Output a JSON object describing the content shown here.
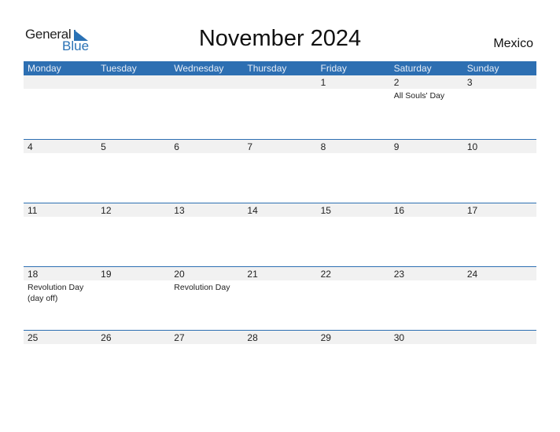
{
  "logo": {
    "word1": "General",
    "word2": "Blue"
  },
  "title": "November 2024",
  "country": "Mexico",
  "colors": {
    "accent": "#2d6fb2",
    "band": "#f1f1f1"
  },
  "weekdays": [
    "Monday",
    "Tuesday",
    "Wednesday",
    "Thursday",
    "Friday",
    "Saturday",
    "Sunday"
  ],
  "weeks": [
    [
      {
        "d": ""
      },
      {
        "d": ""
      },
      {
        "d": ""
      },
      {
        "d": ""
      },
      {
        "d": "1"
      },
      {
        "d": "2",
        "h": "All Souls' Day"
      },
      {
        "d": "3"
      }
    ],
    [
      {
        "d": "4"
      },
      {
        "d": "5"
      },
      {
        "d": "6"
      },
      {
        "d": "7"
      },
      {
        "d": "8"
      },
      {
        "d": "9"
      },
      {
        "d": "10"
      }
    ],
    [
      {
        "d": "11"
      },
      {
        "d": "12"
      },
      {
        "d": "13"
      },
      {
        "d": "14"
      },
      {
        "d": "15"
      },
      {
        "d": "16"
      },
      {
        "d": "17"
      }
    ],
    [
      {
        "d": "18",
        "h": "Revolution Day (day off)"
      },
      {
        "d": "19"
      },
      {
        "d": "20",
        "h": "Revolution Day"
      },
      {
        "d": "21"
      },
      {
        "d": "22"
      },
      {
        "d": "23"
      },
      {
        "d": "24"
      }
    ],
    [
      {
        "d": "25"
      },
      {
        "d": "26"
      },
      {
        "d": "27"
      },
      {
        "d": "28"
      },
      {
        "d": "29"
      },
      {
        "d": "30"
      },
      {
        "d": ""
      }
    ]
  ]
}
